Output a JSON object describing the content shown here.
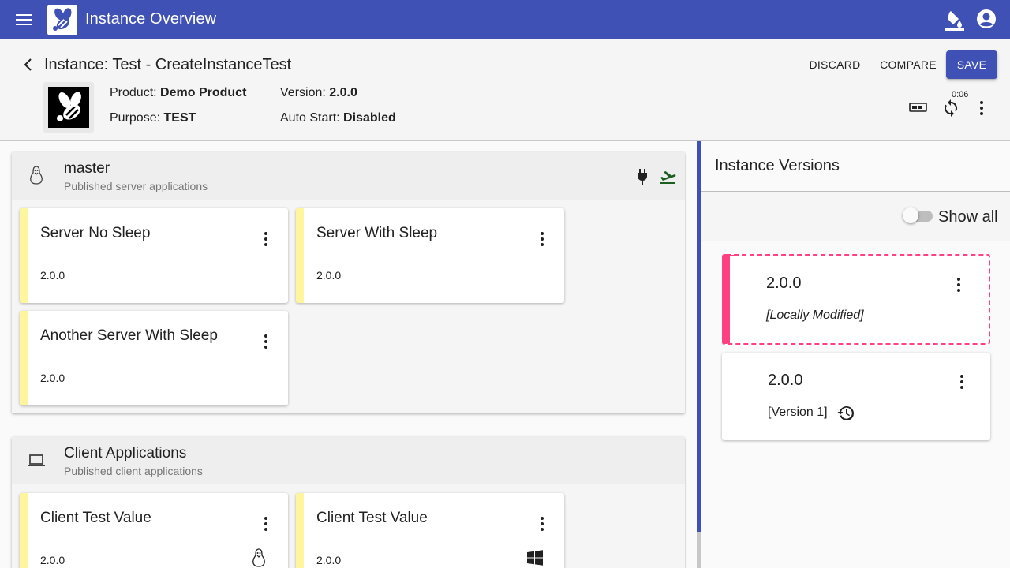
{
  "app": {
    "title": "Instance Overview"
  },
  "header": {
    "title": "Instance: Test - CreateInstanceTest",
    "discard_label": "DISCARD",
    "compare_label": "COMPARE",
    "save_label": "SAVE",
    "product_label": "Product:",
    "product_value": "Demo Product",
    "purpose_label": "Purpose:",
    "purpose_value": "TEST",
    "version_label": "Version:",
    "version_value": "2.0.0",
    "autostart_label": "Auto Start:",
    "autostart_value": "Disabled",
    "timer": "0:06"
  },
  "nodes": [
    {
      "title": "master",
      "subtitle": "Published server applications",
      "icon": "linux-icon",
      "apps": [
        {
          "name": "Server No Sleep",
          "version": "2.0.0"
        },
        {
          "name": "Server With Sleep",
          "version": "2.0.0"
        },
        {
          "name": "Another Server With Sleep",
          "version": "2.0.0"
        }
      ]
    },
    {
      "title": "Client Applications",
      "subtitle": "Published client applications",
      "icon": "laptop-icon",
      "apps": [
        {
          "name": "Client Test Value",
          "version": "2.0.0",
          "os": "linux-icon"
        },
        {
          "name": "Client Test Value",
          "version": "2.0.0",
          "os": "windows-icon"
        }
      ]
    }
  ],
  "versions_panel": {
    "title": "Instance Versions",
    "show_all_label": "Show all",
    "show_all": false,
    "versions": [
      {
        "version": "2.0.0",
        "note": "[Locally Modified]",
        "modified": true
      },
      {
        "version": "2.0.0",
        "note": "[Version 1]",
        "modified": false
      }
    ]
  },
  "colors": {
    "primary": "#3f51b5",
    "accent": "#ff4081",
    "app_stripe": "#fff59d",
    "action_green": "#1b5e20"
  }
}
